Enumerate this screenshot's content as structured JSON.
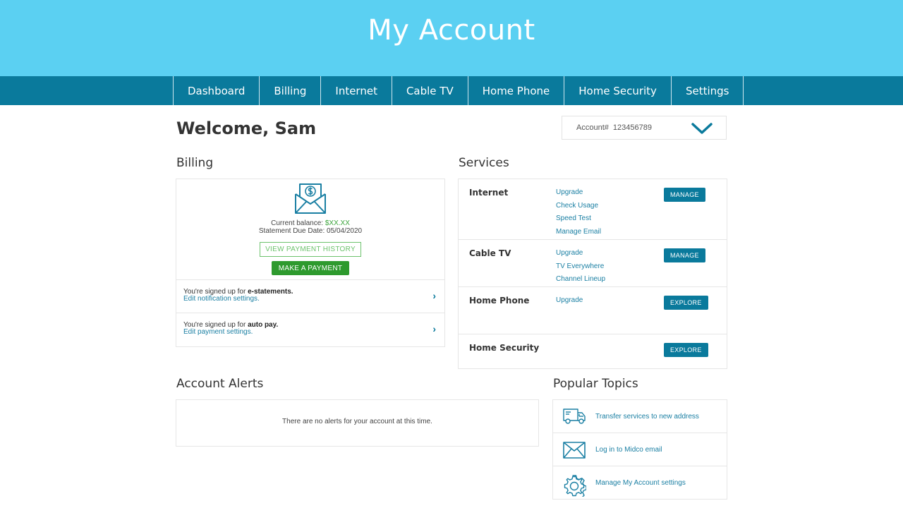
{
  "header": {
    "title": "My Account"
  },
  "nav": [
    {
      "label": "Dashboard"
    },
    {
      "label": "Billing"
    },
    {
      "label": "Internet"
    },
    {
      "label": "Cable TV"
    },
    {
      "label": "Home Phone"
    },
    {
      "label": "Home Security"
    },
    {
      "label": "Settings"
    }
  ],
  "welcome": "Welcome, Sam",
  "account": {
    "label": "Account#",
    "number": "123456789",
    "icon": "chevron-down-icon"
  },
  "billing": {
    "title": "Billing",
    "icon": "bill-envelope-icon",
    "balance_label": "Current balance:",
    "balance_value": "$XX.XX",
    "due_label": "Statement Due Date:",
    "due_value": "05/04/2020",
    "history_button": "VIEW PAYMENT HISTORY",
    "pay_button": "MAKE A PAYMENT",
    "rows": [
      {
        "prefix": "You're signed up for",
        "bold": "e-statements.",
        "link": "Edit notification settings."
      },
      {
        "prefix": "You're signed up for",
        "bold": "auto pay.",
        "link": "Edit payment settings."
      }
    ]
  },
  "services": {
    "title": "Services",
    "items": [
      {
        "name": "Internet",
        "links": [
          "Upgrade",
          "Check Usage",
          "Speed Test",
          "Manage Email"
        ],
        "button": "MANAGE"
      },
      {
        "name": "Cable TV",
        "links": [
          "Upgrade",
          "TV Everywhere",
          "Channel Lineup"
        ],
        "button": "MANAGE"
      },
      {
        "name": "Home Phone",
        "links": [
          "Upgrade"
        ],
        "button": "EXPLORE"
      },
      {
        "name": "Home Security",
        "links": [],
        "button": "EXPLORE"
      }
    ]
  },
  "alerts": {
    "title": "Account Alerts",
    "message": "There are no alerts for your account at this time."
  },
  "topics": {
    "title": "Popular Topics",
    "items": [
      {
        "label": "Transfer services to new address",
        "icon": "truck-icon"
      },
      {
        "label": "Log in to Midco email",
        "icon": "envelope-icon"
      },
      {
        "label": "Manage My Account settings",
        "icon": "gear-icon"
      }
    ]
  },
  "colors": {
    "hero": "#5bd0f2",
    "nav": "#0a7a9c",
    "green": "#2e9a2e",
    "link": "#1a7fa3"
  }
}
